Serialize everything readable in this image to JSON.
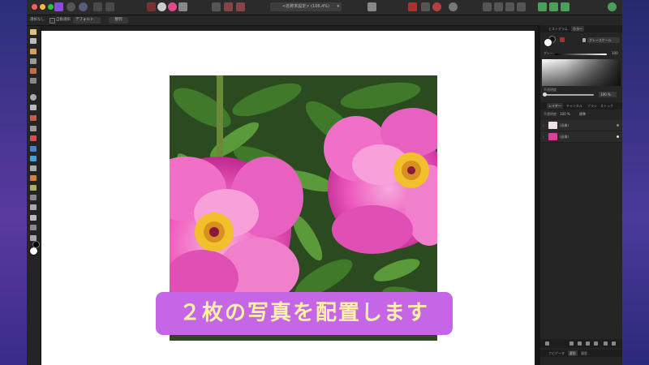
{
  "toolbar": {
    "document_title": "<名称未設定> (106.4%)"
  },
  "context_bar": {
    "selection_label": "選択なし",
    "auto_select_label": "自動選択",
    "layer_dropdown": "デフォルト",
    "action_button": "整列"
  },
  "panels": {
    "top_tabs": [
      "ヒストグラム",
      "カラー"
    ],
    "color_mode": "グレースケール",
    "gray_label": "グレー",
    "gray_value": "100",
    "opacity_label": "不透明度",
    "opacity_value": "100 %",
    "layer_tabs": [
      "レイヤー",
      "チャンネル",
      "ブラシ",
      "ストック"
    ],
    "layer_opacity_label": "不透明度",
    "layer_opacity_value": "100 %",
    "blend_mode": "標準",
    "layers": [
      {
        "name": "(画像)"
      },
      {
        "name": "(画像)"
      }
    ],
    "bottom_tabs": [
      "ナビゲータ",
      "変形",
      "履歴"
    ]
  },
  "canvas": {
    "caption": "２枚の写真を配置します"
  }
}
